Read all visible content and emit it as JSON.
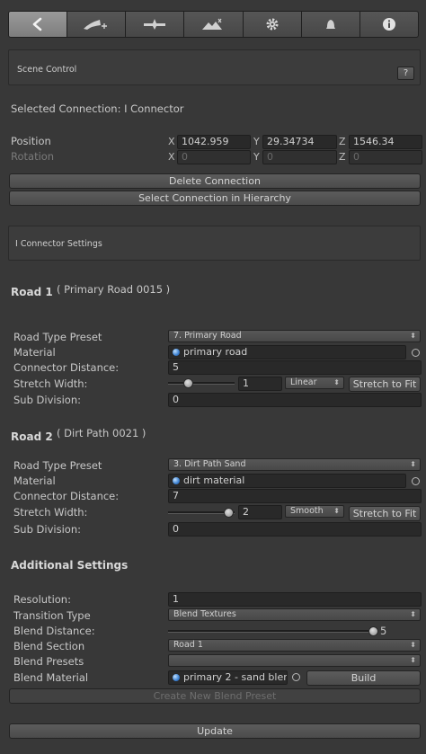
{
  "toolbar": {
    "tabs": [
      {
        "icon": "back-arrow-icon"
      },
      {
        "icon": "add-road-icon"
      },
      {
        "icon": "cross-connection-icon"
      },
      {
        "icon": "terrain-icon"
      },
      {
        "icon": "gear-icon"
      },
      {
        "icon": "bell-icon"
      },
      {
        "icon": "info-icon"
      }
    ]
  },
  "scene_control": {
    "title": "Scene Control",
    "help": "?"
  },
  "selected_connection": "Selected Connection: I Connector",
  "transform": {
    "position_label": "Position",
    "rotation_label": "Rotation",
    "px": "1042.959",
    "py": "29.34734",
    "pz": "1546.34",
    "rx": "0",
    "ry": "0",
    "rz": "0",
    "x": "X",
    "y": "Y",
    "z": "Z"
  },
  "buttons": {
    "delete": "Delete Connection",
    "select_in_hierarchy": "Select Connection in Hierarchy",
    "build": "Build",
    "create_blend_preset": "Create New Blend Preset",
    "update": "Update"
  },
  "connector_settings": {
    "title": "I Connector Settings"
  },
  "road1": {
    "title": "Road 1",
    "name": "( Primary Road 0015 )",
    "type_preset_label": "Road Type Preset",
    "type_preset": "7. Primary Road",
    "material_label": "Material",
    "material": "primary road",
    "connector_distance_label": "Connector Distance:",
    "connector_distance": "5",
    "stretch_width_label": "Stretch Width:",
    "stretch_value": "1",
    "stretch_level": 0.3,
    "stretch_mode": "Linear",
    "stretch_fit": "Stretch to Fit",
    "sub_division_label": "Sub Division:",
    "sub_division": "0"
  },
  "road2": {
    "title": "Road 2",
    "name": "( Dirt Path  0021 )",
    "type_preset_label": "Road Type Preset",
    "type_preset": "3. Dirt Path Sand",
    "material_label": "Material",
    "material": "dirt material",
    "connector_distance_label": "Connector Distance:",
    "connector_distance": "7",
    "stretch_width_label": "Stretch Width:",
    "stretch_value": "2",
    "stretch_level": 0.9,
    "stretch_mode": "Smooth",
    "stretch_fit": "Stretch to Fit",
    "sub_division_label": "Sub Division:",
    "sub_division": "0"
  },
  "additional": {
    "title": "Additional Settings",
    "resolution_label": "Resolution:",
    "resolution": "1",
    "transition_type_label": "Transition Type",
    "transition_type": "Blend Textures",
    "blend_distance_label": "Blend Distance:",
    "blend_distance": "5",
    "blend_level": 0.98,
    "blend_section_label": "Blend Section",
    "blend_section": "Road 1",
    "blend_presets_label": "Blend Presets",
    "blend_presets": "",
    "blend_material_label": "Blend Material",
    "blend_material": "primary 2 - sand bler"
  }
}
